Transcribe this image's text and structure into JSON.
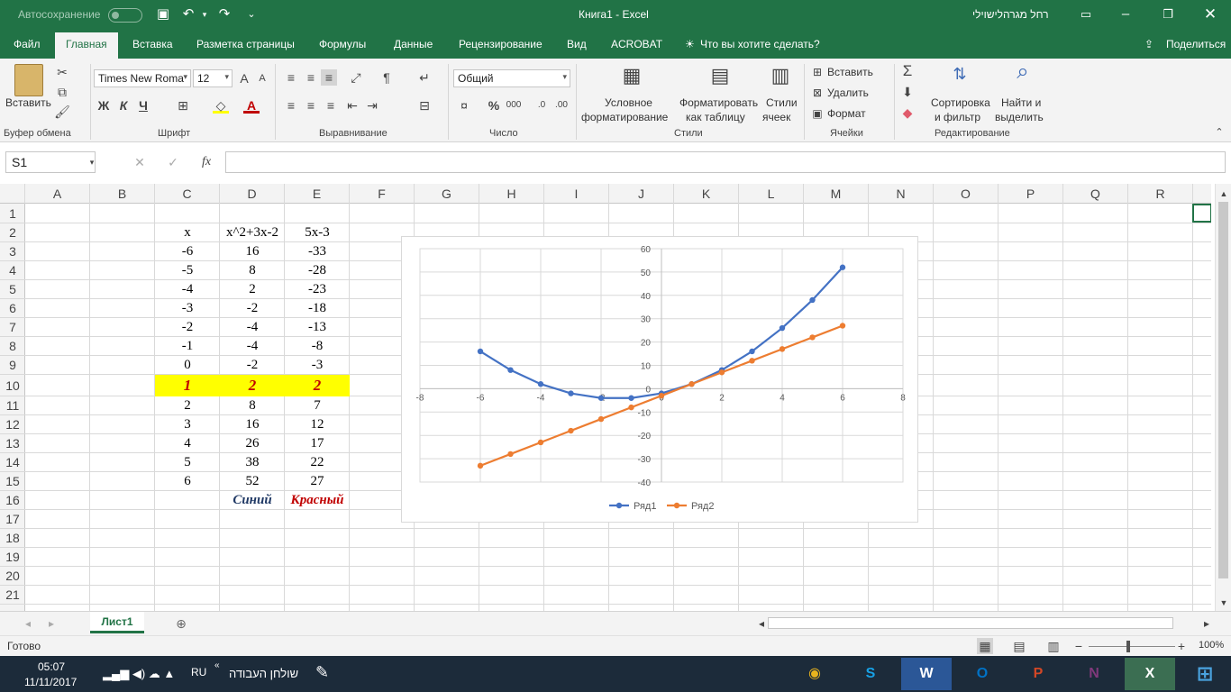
{
  "titlebar": {
    "autosave_label": "Автосохранение",
    "title": "Книга1  -  Excel",
    "user": "רחל מגרהלישוילי"
  },
  "tabs": [
    "Файл",
    "Главная",
    "Вставка",
    "Разметка страницы",
    "Формулы",
    "Данные",
    "Рецензирование",
    "Вид",
    "ACROBAT"
  ],
  "tell_me": "Что вы хотите сделать?",
  "share": "Поделиться",
  "ribbon": {
    "paste": "Вставить",
    "clipboard": "Буфер обмена",
    "font_name": "Times New Roma",
    "font_size": "12",
    "bold": "Ж",
    "italic": "К",
    "underline": "Ч",
    "font": "Шрифт",
    "alignment": "Выравнивание",
    "number_format": "Общий",
    "number": "Число",
    "cond_format_1": "Условное",
    "cond_format_2": "форматирование",
    "format_table_1": "Форматировать",
    "format_table_2": "как таблицу",
    "cell_styles_1": "Стили",
    "cell_styles_2": "ячеек",
    "styles": "Стили",
    "insert": "Вставить",
    "delete": "Удалить",
    "format": "Формат",
    "cells": "Ячейки",
    "sort_1": "Сортировка",
    "sort_2": "и фильтр",
    "find_1": "Найти и",
    "find_2": "выделить",
    "editing": "Редактирование"
  },
  "formula_bar": {
    "name_box": "S1",
    "fx": "fx",
    "value": ""
  },
  "columns": [
    "A",
    "B",
    "C",
    "D",
    "E",
    "F",
    "G",
    "H",
    "I",
    "J",
    "K",
    "L",
    "M",
    "N",
    "O",
    "P",
    "Q",
    "R"
  ],
  "rows": [
    "1",
    "2",
    "3",
    "4",
    "5",
    "6",
    "7",
    "8",
    "9",
    "10",
    "11",
    "12",
    "13",
    "14",
    "15",
    "16",
    "17",
    "18",
    "19",
    "20",
    "21"
  ],
  "table": {
    "headers": [
      "x",
      "x^2+3x-2",
      "5x-3"
    ],
    "rows": [
      [
        "-6",
        "16",
        "-33"
      ],
      [
        "-5",
        "8",
        "-28"
      ],
      [
        "-4",
        "2",
        "-23"
      ],
      [
        "-3",
        "-2",
        "-18"
      ],
      [
        "-2",
        "-4",
        "-13"
      ],
      [
        "-1",
        "-4",
        "-8"
      ],
      [
        "0",
        "-2",
        "-3"
      ],
      [
        "1",
        "2",
        "2"
      ],
      [
        "2",
        "8",
        "7"
      ],
      [
        "3",
        "16",
        "12"
      ],
      [
        "4",
        "26",
        "17"
      ],
      [
        "5",
        "38",
        "22"
      ],
      [
        "6",
        "52",
        "27"
      ]
    ],
    "legend_labels": [
      "Синий",
      "Красный"
    ]
  },
  "chart_data": {
    "type": "scatter",
    "x": [
      -6,
      -5,
      -4,
      -3,
      -2,
      -1,
      0,
      1,
      2,
      3,
      4,
      5,
      6
    ],
    "series": [
      {
        "name": "Ряд1",
        "color": "#4472c4",
        "values": [
          16,
          8,
          2,
          -2,
          -4,
          -4,
          -2,
          2,
          8,
          16,
          26,
          38,
          52
        ]
      },
      {
        "name": "Ряд2",
        "color": "#ed7d31",
        "values": [
          -33,
          -28,
          -23,
          -18,
          -13,
          -8,
          -3,
          2,
          7,
          12,
          17,
          22,
          27
        ]
      }
    ],
    "xlim": [
      -8,
      8
    ],
    "ylim": [
      -40,
      60
    ],
    "xticks": [
      "-8",
      "-6",
      "-4",
      "-2",
      "0",
      "2",
      "4",
      "6",
      "8"
    ],
    "yticks": [
      "60",
      "50",
      "40",
      "30",
      "20",
      "10",
      "0",
      "-10",
      "-20",
      "-30",
      "-40"
    ],
    "grid": true,
    "legend": "bottom"
  },
  "sheet_tab": "Лист1",
  "status": {
    "ready": "Готово",
    "zoom": "100%"
  },
  "taskbar": {
    "time": "05:07",
    "date": "11/11/2017",
    "lang": "RU",
    "desktop": "שולחן העבודה"
  }
}
